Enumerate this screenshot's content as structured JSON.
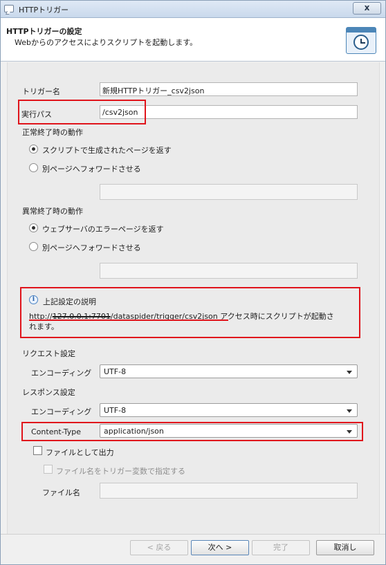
{
  "window": {
    "title": "HTTPトリガー",
    "close_label": "x"
  },
  "header": {
    "title": "HTTPトリガーの設定",
    "subtitle": "Webからのアクセスによりスクリプトを起動します。",
    "icon": "clock-icon"
  },
  "form": {
    "trigger_name_label": "トリガー名",
    "trigger_name_value": "新規HTTPトリガー_csv2json",
    "exec_path_label": "実行パス",
    "exec_path_value": "/csv2json",
    "success_section_label": "正常終了時の動作",
    "success_option_1": "スクリプトで生成されたページを返す",
    "success_option_2": "別ページへフォワードさせる",
    "error_section_label": "異常終了時の動作",
    "error_option_1": "ウェブサーバのエラーページを返す",
    "error_option_2": "別ページへフォワードさせる",
    "description_title": "上記設定の説明",
    "description_url_prefix": "http://",
    "description_url_host": "127.0.0.1:7701",
    "description_url_path": "/dataspider/trigger/csv2json",
    "description_text_1": " アクセス時にスクリプトが起動さ",
    "description_text_2": "れます。",
    "request_section_label": "リクエスト設定",
    "request_encoding_label": "エンコーディング",
    "request_encoding_value": "UTF-8",
    "response_section_label": "レスポンス設定",
    "response_encoding_label": "エンコーディング",
    "response_encoding_value": "UTF-8",
    "content_type_label": "Content-Type",
    "content_type_value": "application/json",
    "output_as_file_label": "ファイルとして出力",
    "filename_by_var_label": "ファイル名をトリガー変数で指定する",
    "filename_label": "ファイル名",
    "filename_value": ""
  },
  "buttons": {
    "back": "< 戻る",
    "next": "次へ >",
    "finish": "完了",
    "cancel": "取消し"
  },
  "state": {
    "success_selected": 1,
    "error_selected": 1,
    "output_as_file_checked": false,
    "filename_by_var_enabled": false
  },
  "colors": {
    "highlight": "#e0141b",
    "accent": "#4c86b8"
  }
}
